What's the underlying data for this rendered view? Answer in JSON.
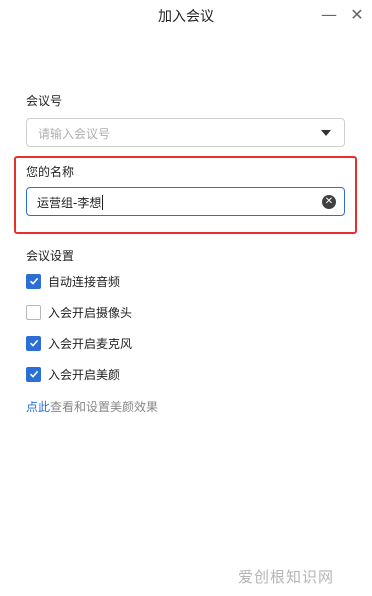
{
  "window": {
    "title": "加入会议",
    "minimize_glyph": "—",
    "close_glyph": "✕"
  },
  "meeting_id": {
    "label": "会议号",
    "placeholder": "请输入会议号"
  },
  "name": {
    "label": "您的名称",
    "value": "运营组-李想"
  },
  "settings": {
    "label": "会议设置",
    "options": [
      {
        "label": "自动连接音频",
        "checked": true
      },
      {
        "label": "入会开启摄像头",
        "checked": false
      },
      {
        "label": "入会开启麦克风",
        "checked": true
      },
      {
        "label": "入会开启美颜",
        "checked": true
      }
    ]
  },
  "beauty": {
    "link_text": "点此",
    "rest_text": "查看和设置美颜效果"
  },
  "watermark": "爱创根知识网",
  "colors": {
    "accent": "#2b6fd6",
    "highlight": "#e8302a"
  },
  "icons": {
    "dropdown": "chevron-down-icon",
    "clear": "clear-icon",
    "check": "checkmark-icon"
  }
}
